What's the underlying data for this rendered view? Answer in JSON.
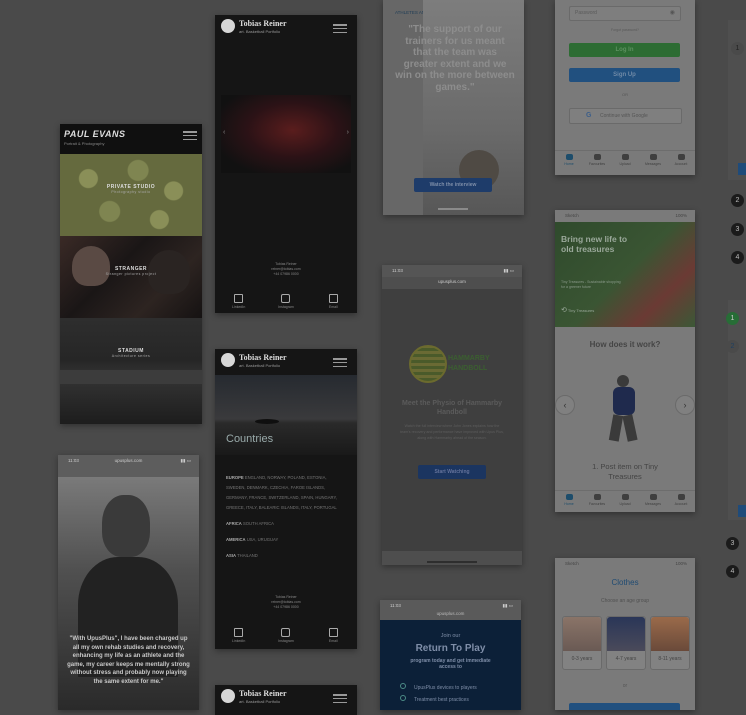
{
  "paul_evans": {
    "logo": "PAUL EVANS",
    "subtitle": "Portrait & Photography",
    "sections": [
      {
        "label": "PRIVATE STUDIO",
        "sub": "Photography studio"
      },
      {
        "label": "STRANGER",
        "sub": "Stranger pictures project"
      },
      {
        "label": "STADIUM",
        "sub": "Architecture series"
      }
    ]
  },
  "tobias_top": {
    "name": "Tobias Reiner",
    "sub": "art. Basketball Portfolio",
    "footer": [
      "Tobias Reiner",
      "reiner@tobias.com",
      "+44 07986 0000"
    ],
    "icons": [
      "LinkedIn",
      "Instagram",
      "Email"
    ]
  },
  "tobias_mid": {
    "name": "Tobias Reiner",
    "sub": "art. Basketball Portfolio",
    "hero_title": "Countries",
    "europe_label": "EUROPE",
    "europe_text": "ENGLAND, NORWAY, POLAND, ESTONIA, SWEDEN, DENMARK, CZECHIA, FAROE ISLANDS, GERMANY, FRANCE, SWITZERLAND, SPAIN, HUNGARY, GREECE, ITALY, BALEARIC ISLANDS, ITALY, PORTUGAL",
    "africa_label": "AFRICA",
    "africa_text": "SOUTH AFRICA",
    "america_label": "AMERICA",
    "america_text": "USA, URUGUAY",
    "asia_label": "ASIA",
    "asia_text": "THAILAND",
    "footer": [
      "Tobias Reiner",
      "reiner@tobias.com",
      "+44 07986 0000"
    ],
    "icons": [
      "LinkedIn",
      "Instagram",
      "Email"
    ]
  },
  "tobias_bottom": {
    "name": "Tobias Reiner",
    "sub": "art. Basketball Portfolio"
  },
  "upus_portrait": {
    "time": "11:03",
    "url": "upusplus.com",
    "quote": "\"With UpusPlus\", I have been charged up all my own rehab studies and recovery, enhancing my life as an athlete and the game, my career keeps me mentally strong without stress and probably now playing the same extent for me.\""
  },
  "quote_top": {
    "eyebrow": "ATHLETES AND UPUS PLUS",
    "quote": "\"The support of our trainers for us meant that the team was greater extent and we win on the more between games.\"",
    "button": "Watch the interview"
  },
  "hammarby": {
    "time": "11:03",
    "url": "upusplus.com",
    "brand_top": "HAMMARBY",
    "brand_bottom": "HANDBOLL",
    "title": "Meet the Physio of Hammarby Handboll",
    "body": "Watch the full interview where John Jones explains how the team's recovery and performance have improved with Upus Plus, along with Hammarby ahead of the season.",
    "button": "Start Watching"
  },
  "return_to_play": {
    "time": "11:03",
    "url": "upusplus.com",
    "eyebrow": "Join our",
    "title": "Return To Play",
    "subtitle": "program today and get immediate access to",
    "items": [
      "UpusPlus devices to players",
      "Treatment best practices"
    ]
  },
  "login": {
    "password_placeholder": "Password",
    "forgot": "Forgot password?",
    "login_button": "Log In",
    "signup_button": "Sign Up",
    "or": "OR",
    "google_button": "Continue with Google",
    "tabs": [
      "Home",
      "Favourites",
      "Upload",
      "Messages",
      "Account"
    ]
  },
  "tiny_home": {
    "status_left": "Sketch",
    "status_right": "100%",
    "hero_title": "Bring new life to old treasures",
    "hero_sub": "Tiny Treasures - Sustainable shopping for a greener future",
    "hero_logo": "Tiny Treasures",
    "how_title": "How does it work?",
    "step": "1. Post item on Tiny Treasures",
    "tabs": [
      "Home",
      "Favourites",
      "Upload",
      "Messages",
      "Account"
    ]
  },
  "tiny_clothes": {
    "status_left": "Sketch",
    "status_right": "100%",
    "title": "Clothes",
    "subtitle": "Choose an age group",
    "ages": [
      "0-3 years",
      "4-7 years",
      "8-11 years"
    ],
    "or": "or"
  },
  "steps_right": {
    "numbers": [
      "1",
      "2",
      "3",
      "4",
      "1",
      "2",
      "3",
      "4"
    ]
  }
}
